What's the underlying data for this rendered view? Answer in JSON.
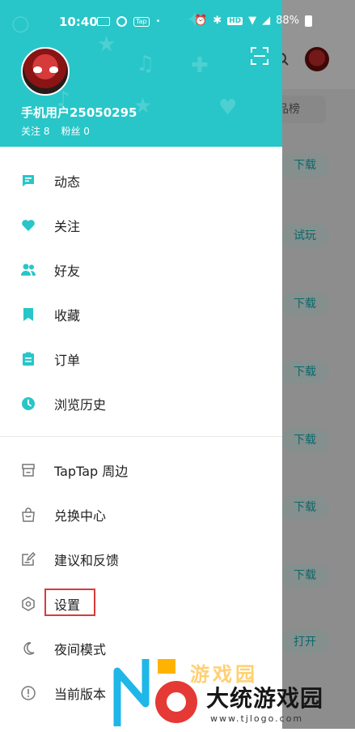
{
  "status_bar": {
    "time": "10:40",
    "tap_badge": "Tap",
    "hd_badge": "HD",
    "battery": "88%"
  },
  "background": {
    "tab_chip": "品榜",
    "buttons": [
      "下载",
      "试玩",
      "下载",
      "下载",
      "下载",
      "下载",
      "下载",
      "打开"
    ]
  },
  "drawer": {
    "user": {
      "name": "手机用户25050295",
      "following": "关注 8",
      "fans": "粉丝 0"
    },
    "menu_primary": [
      {
        "label": "动态",
        "icon": "message-icon"
      },
      {
        "label": "关注",
        "icon": "heart-icon"
      },
      {
        "label": "好友",
        "icon": "friends-icon"
      },
      {
        "label": "收藏",
        "icon": "bookmark-icon"
      },
      {
        "label": "订单",
        "icon": "clipboard-icon"
      },
      {
        "label": "浏览历史",
        "icon": "clock-icon"
      }
    ],
    "menu_secondary": [
      {
        "label": "TapTap 周边",
        "icon": "store-icon"
      },
      {
        "label": "兑换中心",
        "icon": "bag-icon"
      },
      {
        "label": "建议和反馈",
        "icon": "edit-icon"
      },
      {
        "label": "设置",
        "icon": "settings-icon"
      },
      {
        "label": "夜间模式",
        "icon": "moon-icon"
      },
      {
        "label": "当前版本",
        "icon": "info-icon"
      }
    ],
    "accent_color": "#28c6c8"
  },
  "watermark": {
    "text": "大统游戏园",
    "url": "www.tjlogo.com"
  }
}
